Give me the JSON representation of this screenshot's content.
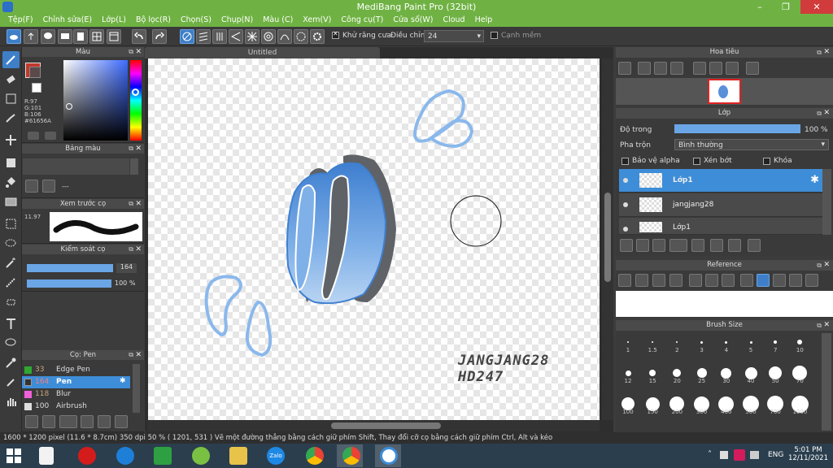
{
  "app": {
    "title": "MediBang Paint Pro (32bit)",
    "window_controls": {
      "minimize": "–",
      "restore": "❐",
      "close": "✕"
    }
  },
  "menu": [
    "Tệp(F)",
    "Chỉnh sửa(E)",
    "Lớp(L)",
    "Bộ lọc(R)",
    "Chọn(S)",
    "Chụp(N)",
    "Màu (C)",
    "Xem(V)",
    "Công cụ(T)",
    "Cửa sổ(W)",
    "Cloud",
    "Help"
  ],
  "toolbar": {
    "antialias_label": "Khử răng cưa",
    "antialias_checked": true,
    "correction_label": "Điều chỉnh",
    "correction_value": "24",
    "snap_label": "Cạnh mềm",
    "snap_checked": false
  },
  "color_panel": {
    "title": "Màu",
    "r": "R:97",
    "g": "G:101",
    "b": "B:106",
    "hex": "#61656A"
  },
  "palette_panel": {
    "title": "Bảng màu",
    "value": "---"
  },
  "brush_preview": {
    "title": "Xem trước cọ",
    "size_label": "11.97"
  },
  "brush_control": {
    "title": "Kiểm soát cọ",
    "size": "164",
    "opacity": "100 %"
  },
  "brush_list": {
    "title": "Cọ: Pen",
    "items": [
      {
        "size": "33",
        "name": "Edge Pen",
        "color": "#2fa832"
      },
      {
        "size": "164",
        "name": "Pen",
        "color": "#333333",
        "selected": true
      },
      {
        "size": "118",
        "name": "Blur",
        "color": "#f060d8"
      },
      {
        "size": "100",
        "name": "Airbrush",
        "color": "#dddddd"
      }
    ]
  },
  "canvas": {
    "tab_title": "Untitled",
    "signature_line1": "JANGJANG28",
    "signature_line2": "HD247"
  },
  "navigator": {
    "title": "Hoa tiêu"
  },
  "layers": {
    "title": "Lớp",
    "opacity_label": "Độ trong",
    "opacity_value": "100 %",
    "blend_label": "Pha trộn",
    "blend_value": "Bình thường",
    "protect_alpha": "Bảo vệ alpha",
    "clipping": "Xén bớt",
    "lock": "Khóa",
    "items": [
      {
        "name": "Lớp1",
        "selected": true
      },
      {
        "name": "jangjang28",
        "selected": false
      },
      {
        "name": "Lớp1",
        "selected": false
      }
    ]
  },
  "reference": {
    "title": "Reference"
  },
  "brush_size": {
    "title": "Brush Size",
    "sizes": [
      "1",
      "1.5",
      "2",
      "3",
      "4",
      "5",
      "7",
      "10",
      "12",
      "15",
      "20",
      "25",
      "30",
      "40",
      "50",
      "70",
      "100",
      "150",
      "200",
      "300",
      "400",
      "500",
      "700",
      "1000"
    ]
  },
  "status": {
    "text": "1600 * 1200 pixel   (11.6 * 8.7cm)   350 dpi   50 %   ( 1201, 531 )   Vẽ một đường thẳng bằng cách giữ phím Shift, Thay đổi cỡ cọ bằng cách giữ phím Ctrl, Alt và kéo"
  },
  "taskbar": {
    "lang": "ENG",
    "time": "5:01 PM",
    "date": "12/11/2021",
    "zalo": "Zalo"
  }
}
